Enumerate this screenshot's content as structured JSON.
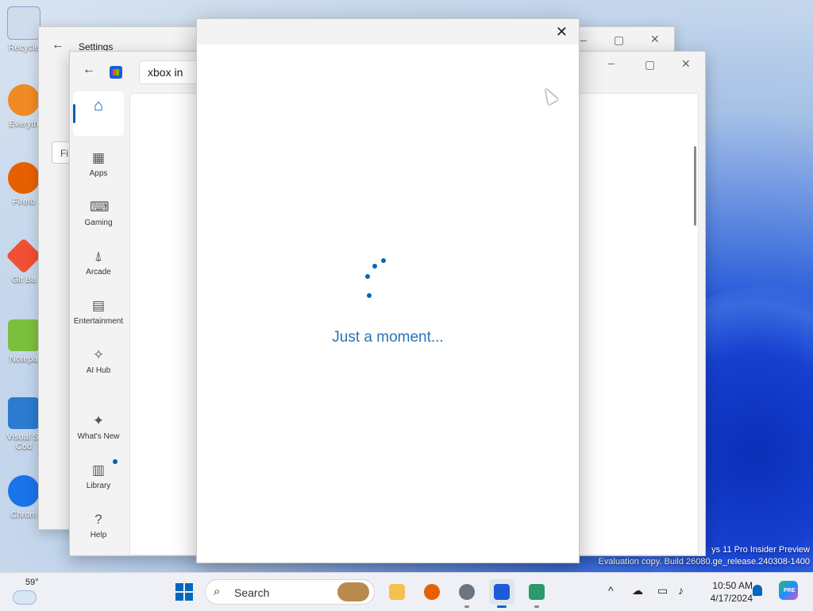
{
  "desktop": {
    "icons": [
      {
        "label": "Recycle",
        "color": "#9ab4d4"
      },
      {
        "label": "Everyth",
        "color": "#f08a24"
      },
      {
        "label": "Firefo",
        "color": "#e66000"
      },
      {
        "label": "Git Ba",
        "color": "#f05033"
      },
      {
        "label": "Notepa",
        "color": "#7bbf3e"
      },
      {
        "label": "Visual St\nCod",
        "color": "#2b7bd0"
      },
      {
        "label": "Chrom",
        "color": "#1a73e8"
      }
    ],
    "watermark_line1": "ys 11 Pro Insider Preview",
    "watermark_line2": "Evaluation copy. Build 26080.ge_release.240308-1400"
  },
  "settings_window": {
    "title": "Settings",
    "search_placeholder": "Fi"
  },
  "store_window": {
    "search_value": "xbox in",
    "nav": [
      {
        "label": "",
        "icon": "home-icon"
      },
      {
        "label": "Apps",
        "icon": "apps-icon"
      },
      {
        "label": "Gaming",
        "icon": "gamepad-icon"
      },
      {
        "label": "Arcade",
        "icon": "joystick-icon"
      },
      {
        "label": "Entertainment",
        "icon": "clapperboard-icon"
      },
      {
        "label": "AI Hub",
        "icon": "sparkle-icon"
      },
      {
        "label": "What's New",
        "icon": "party-icon"
      },
      {
        "label": "Library",
        "icon": "library-icon"
      },
      {
        "label": "Help",
        "icon": "help-icon"
      }
    ]
  },
  "dialog": {
    "loading_text": "Just a moment..."
  },
  "taskbar": {
    "weather_temp": "59°",
    "search_label": "Search",
    "time": "10:50 AM",
    "date": "4/17/2024",
    "copilot_badge": "PRE"
  }
}
